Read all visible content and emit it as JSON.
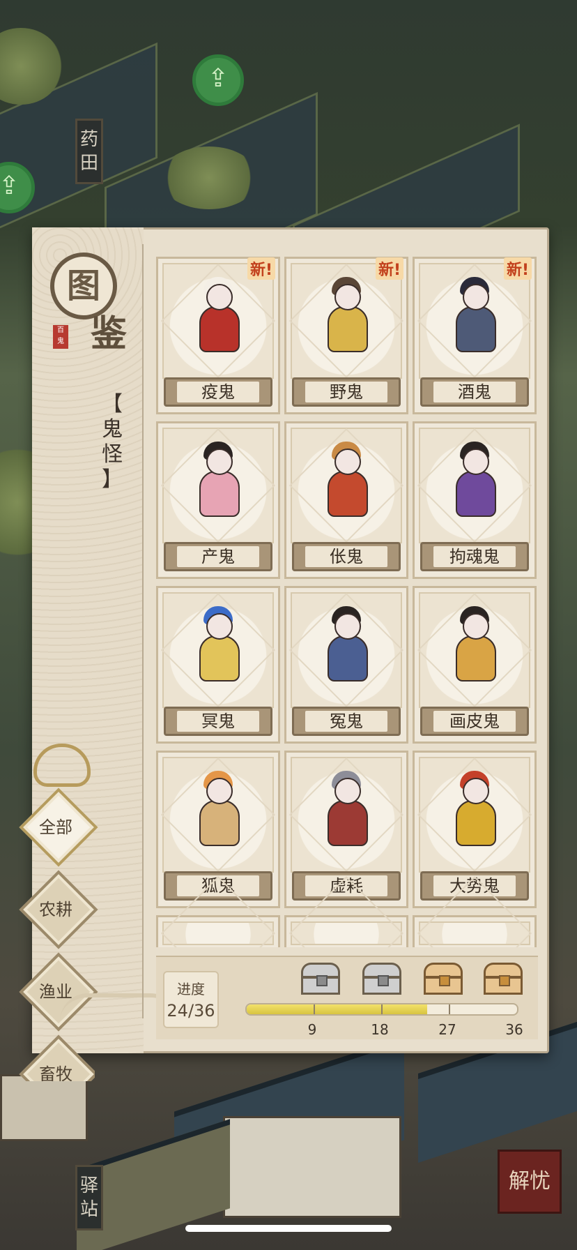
{
  "map": {
    "signpost_top": "药田",
    "signpost_bottom": "驿站",
    "corner_button": "解忧"
  },
  "panel": {
    "emblem_top": "图",
    "emblem_bottom": "鉴",
    "emblem_seal": "百鬼",
    "category_title": "【鬼怪】"
  },
  "filters": [
    {
      "label": "全部",
      "active": true
    },
    {
      "label": "农耕",
      "active": false
    },
    {
      "label": "渔业",
      "active": false
    },
    {
      "label": "畜牧",
      "active": false
    }
  ],
  "new_badge": "新!",
  "cards": [
    {
      "name": "疫鬼",
      "is_new": true,
      "robe_color": "#b8322a",
      "hair_color": "#f4efe6"
    },
    {
      "name": "野鬼",
      "is_new": true,
      "robe_color": "#d9b44a",
      "hair_color": "#5a4637"
    },
    {
      "name": "酒鬼",
      "is_new": true,
      "robe_color": "#4e5a77",
      "hair_color": "#2b2b3a"
    },
    {
      "name": "产鬼",
      "is_new": false,
      "robe_color": "#e7a4b4",
      "hair_color": "#2a2422"
    },
    {
      "name": "伥鬼",
      "is_new": false,
      "robe_color": "#c44a2e",
      "hair_color": "#c98a45"
    },
    {
      "name": "拘魂鬼",
      "is_new": false,
      "robe_color": "#6f4a9c",
      "hair_color": "#2a2422"
    },
    {
      "name": "冥鬼",
      "is_new": false,
      "robe_color": "#e2c45a",
      "hair_color": "#3c6cc8"
    },
    {
      "name": "冤鬼",
      "is_new": false,
      "robe_color": "#4b5f92",
      "hair_color": "#2a2422"
    },
    {
      "name": "画皮鬼",
      "is_new": false,
      "robe_color": "#d9a445",
      "hair_color": "#2a2422"
    },
    {
      "name": "狐鬼",
      "is_new": false,
      "robe_color": "#d7b27a",
      "hair_color": "#e49648"
    },
    {
      "name": "虚耗",
      "is_new": false,
      "robe_color": "#9c3a34",
      "hair_color": "#8d8d98"
    },
    {
      "name": "大势鬼",
      "is_new": false,
      "robe_color": "#d7ab2f",
      "hair_color": "#c4412a"
    }
  ],
  "progress": {
    "label": "进度",
    "value_text": "24/36",
    "current": 24,
    "total": 36,
    "milestones": [
      {
        "value": "9",
        "chest": "grey"
      },
      {
        "value": "18",
        "chest": "grey"
      },
      {
        "value": "27",
        "chest": "gold"
      },
      {
        "value": "36",
        "chest": "gold"
      }
    ]
  }
}
